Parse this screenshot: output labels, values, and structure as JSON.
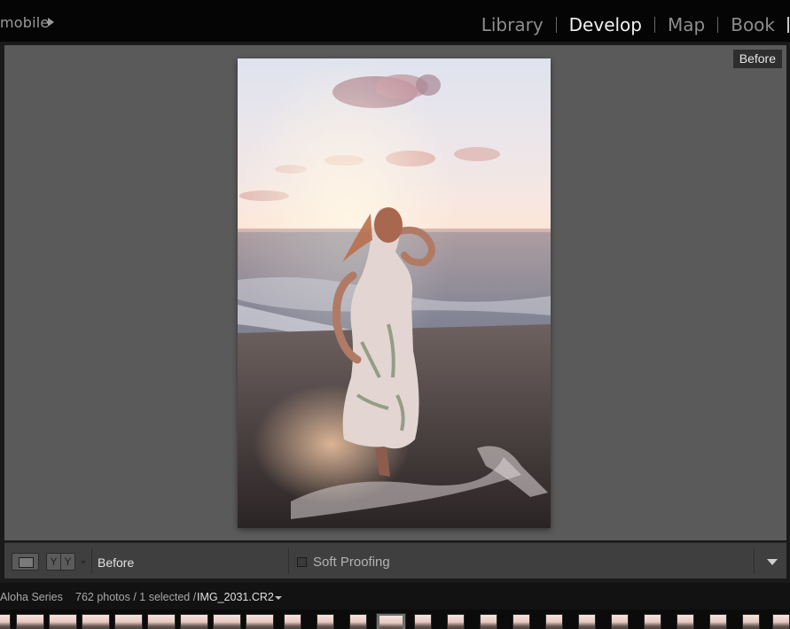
{
  "identity": {
    "label": "mobile"
  },
  "modules": {
    "items": [
      {
        "label": "Library",
        "active": false
      },
      {
        "label": "Develop",
        "active": true
      },
      {
        "label": "Map",
        "active": false
      },
      {
        "label": "Book",
        "active": false
      }
    ]
  },
  "view": {
    "overlay_label": "Before",
    "photo": {
      "description_icon": "photo-icon"
    }
  },
  "toolbar": {
    "loupe_icon": "loupe-view-icon",
    "before_after_glyphs": [
      "Y",
      "Y"
    ],
    "view_label": "Before",
    "soft_proofing_label": "Soft Proofing",
    "soft_proofing_checked": false
  },
  "filmstrip": {
    "source": "Aloha Series",
    "count": "762 photos / 1 selected /",
    "filename": "IMG_2031.CR2"
  },
  "colors": {
    "active_module": "#f0f0f0",
    "inactive_module": "#8d8d8d",
    "view_background": "#5a5a5a"
  }
}
